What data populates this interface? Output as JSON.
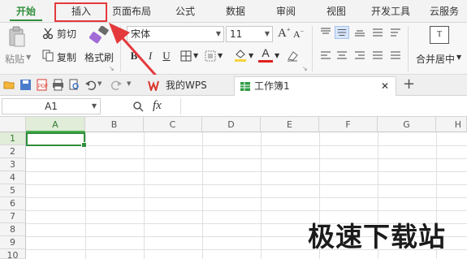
{
  "menu": {
    "tabs": [
      {
        "label": "开始",
        "active": true
      },
      {
        "label": "插入",
        "active": false
      },
      {
        "label": "页面布局",
        "active": false
      },
      {
        "label": "公式",
        "active": false
      },
      {
        "label": "数据",
        "active": false
      },
      {
        "label": "审阅",
        "active": false
      },
      {
        "label": "视图",
        "active": false
      },
      {
        "label": "开发工具",
        "active": false
      },
      {
        "label": "云服务",
        "active": false
      }
    ]
  },
  "ribbon": {
    "paste_label": "粘贴",
    "cut_label": "剪切",
    "copy_label": "复制",
    "format_painter_label": "格式刷",
    "font_name": "宋体",
    "font_size": "11",
    "grow_font": "A",
    "shrink_font": "A",
    "bold": "B",
    "italic": "I",
    "underline": "U",
    "font_color_letter": "A",
    "merge_label": "合并居中",
    "merge_icon_letter": "T"
  },
  "doc_tabs": [
    {
      "label": "我的WPS",
      "active": false
    },
    {
      "label": "工作簿1",
      "active": true
    }
  ],
  "formula_bar": {
    "name_box": "A1",
    "fx_label": "fx",
    "zoom_icon": "magnifier-icon"
  },
  "sheet": {
    "columns": [
      "A",
      "B",
      "C",
      "D",
      "E",
      "F",
      "G",
      "H"
    ],
    "rows": [
      "1",
      "2",
      "3",
      "4",
      "5",
      "6",
      "7",
      "8",
      "9",
      "10"
    ],
    "selected_cell": "A1"
  },
  "watermark": "极速下载站",
  "colors": {
    "accent_green": "#2f8e3a",
    "annotation_red": "#e4393c",
    "font_color_red": "#e02020",
    "highlight_yellow": "#f7d23c"
  }
}
